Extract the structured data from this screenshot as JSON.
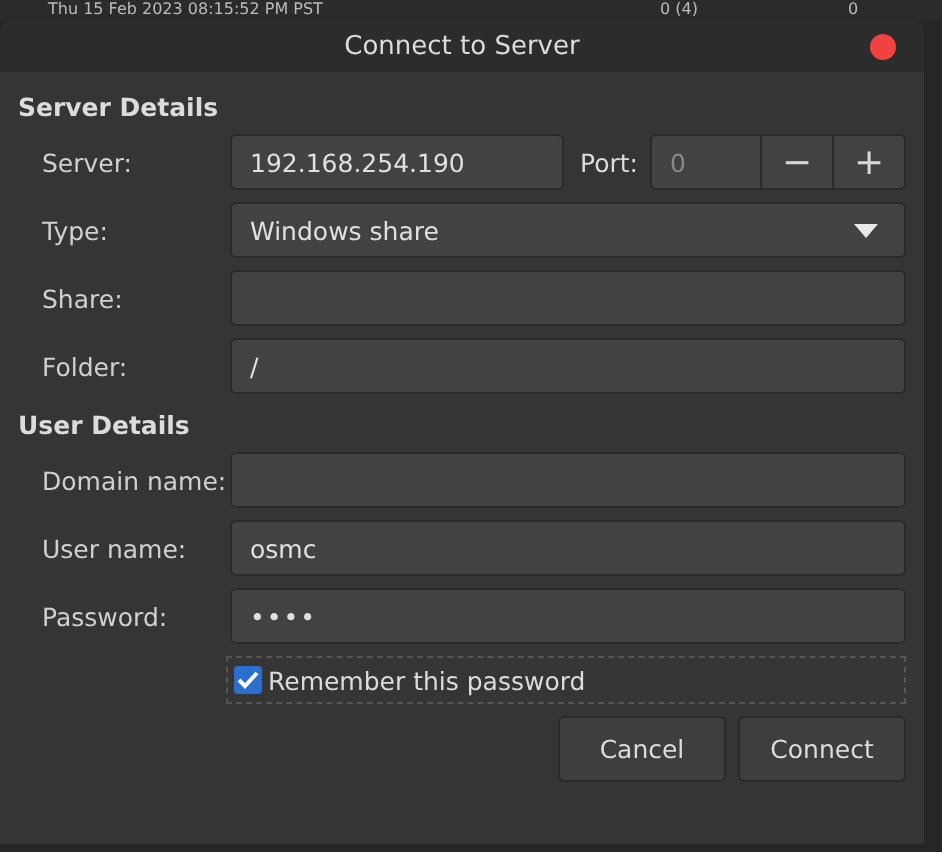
{
  "background": {
    "texts": [
      "Thu 15 Feb 2023 08:15:52 PM PST",
      "0 (4)",
      "0"
    ]
  },
  "window": {
    "title": "Connect to Server"
  },
  "server_details": {
    "heading": "Server Details",
    "server": {
      "label": "Server:",
      "value": "192.168.254.190"
    },
    "port": {
      "label": "Port:",
      "placeholder": "0",
      "minus": "−",
      "plus": "+"
    },
    "type": {
      "label": "Type:",
      "value": "Windows share"
    },
    "share": {
      "label": "Share:"
    },
    "folder": {
      "label": "Folder:",
      "value": "/"
    }
  },
  "user_details": {
    "heading": "User Details",
    "fields": [
      {
        "label": "Domain name:",
        "kind": "text"
      },
      {
        "label": "User name:",
        "value": "osmc",
        "kind": "text"
      },
      {
        "label": "Password:",
        "value": "••••",
        "kind": "password"
      }
    ],
    "remember": {
      "label": "Remember this password",
      "checked": true
    }
  },
  "buttons": [
    "Cancel",
    "Connect"
  ]
}
